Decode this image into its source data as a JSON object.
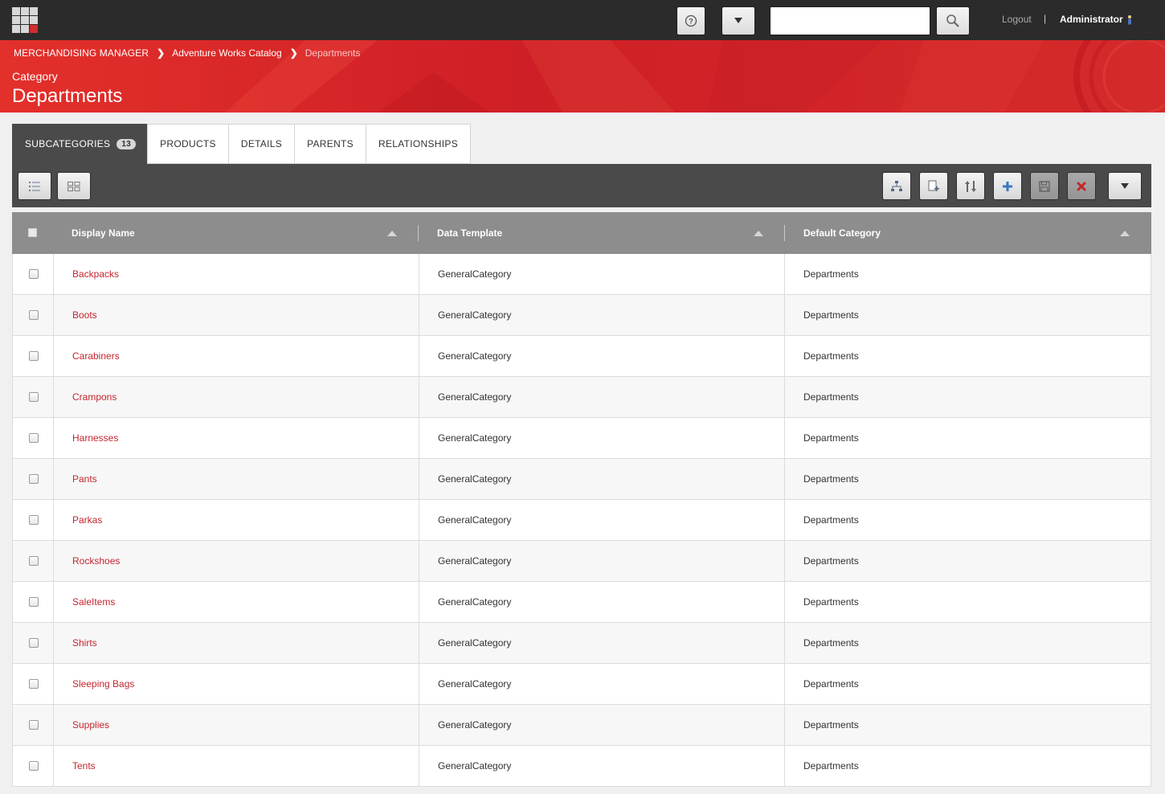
{
  "topbar": {
    "search_placeholder": "",
    "logout_label": "Logout",
    "separator": "|",
    "user_name": "Administrator"
  },
  "breadcrumb": {
    "items": [
      "MERCHANDISING MANAGER",
      "Adventure Works Catalog"
    ],
    "current": "Departments"
  },
  "page": {
    "kicker": "Category",
    "title": "Departments"
  },
  "tabs": [
    {
      "label": "SUBCATEGORIES",
      "badge": "13",
      "active": true
    },
    {
      "label": "PRODUCTS"
    },
    {
      "label": "DETAILS"
    },
    {
      "label": "PARENTS"
    },
    {
      "label": "RELATIONSHIPS"
    }
  ],
  "toolbar": {
    "left": [
      "list-view-icon",
      "tile-view-icon"
    ],
    "right": [
      "hierarchy-icon",
      "add-existing-icon",
      "sort-order-icon",
      "add-icon",
      "save-icon",
      "delete-icon",
      "more-icon"
    ]
  },
  "grid": {
    "columns": [
      "Display Name",
      "Data Template",
      "Default Category"
    ],
    "rows": [
      {
        "name": "Backpacks",
        "template": "GeneralCategory",
        "default": "Departments"
      },
      {
        "name": "Boots",
        "template": "GeneralCategory",
        "default": "Departments"
      },
      {
        "name": "Carabiners",
        "template": "GeneralCategory",
        "default": "Departments"
      },
      {
        "name": "Crampons",
        "template": "GeneralCategory",
        "default": "Departments"
      },
      {
        "name": "Harnesses",
        "template": "GeneralCategory",
        "default": "Departments"
      },
      {
        "name": "Pants",
        "template": "GeneralCategory",
        "default": "Departments"
      },
      {
        "name": "Parkas",
        "template": "GeneralCategory",
        "default": "Departments"
      },
      {
        "name": "Rockshoes",
        "template": "GeneralCategory",
        "default": "Departments"
      },
      {
        "name": "SaleItems",
        "template": "GeneralCategory",
        "default": "Departments"
      },
      {
        "name": "Shirts",
        "template": "GeneralCategory",
        "default": "Departments"
      },
      {
        "name": "Sleeping Bags",
        "template": "GeneralCategory",
        "default": "Departments"
      },
      {
        "name": "Supplies",
        "template": "GeneralCategory",
        "default": "Departments"
      },
      {
        "name": "Tents",
        "template": "GeneralCategory",
        "default": "Departments"
      }
    ]
  },
  "colors": {
    "brand_red": "#d92426",
    "link_red": "#c4262e",
    "topbar": "#2b2b2b",
    "toolbar": "#4a4a4a",
    "grid_header": "#8d8d8d"
  }
}
